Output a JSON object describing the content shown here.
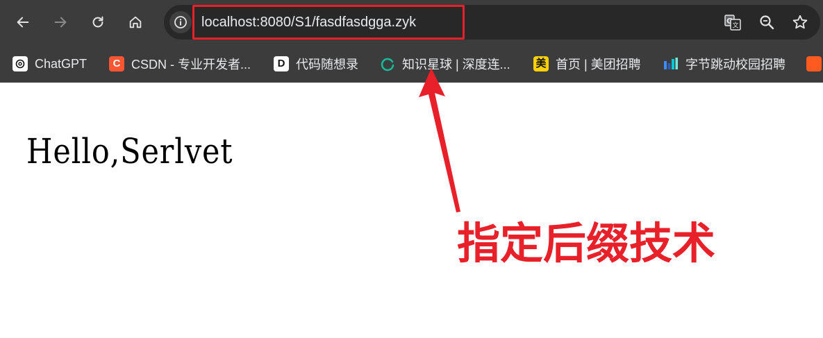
{
  "toolbar": {
    "back_icon": "arrow-left-icon",
    "forward_icon": "arrow-right-icon",
    "reload_icon": "reload-icon",
    "home_icon": "home-icon",
    "url": "localhost:8080/S1/fasdfasdgga.zyk",
    "translate_icon": "translate-icon",
    "zoom_icon": "magnifier-icon",
    "bookmark_icon": "star-icon"
  },
  "bookmarks": [
    {
      "label": "ChatGPT",
      "icon": "chatgpt-icon"
    },
    {
      "label": "CSDN - 专业开发者...",
      "icon": "csdn-icon",
      "icon_text": "C",
      "color": "#fc5531"
    },
    {
      "label": "代码随想录",
      "icon": "daimasuixianglu-icon",
      "icon_text": "D"
    },
    {
      "label": "知识星球 | 深度连...",
      "icon": "zsxq-icon"
    },
    {
      "label": "首页 | 美团招聘",
      "icon": "meituan-icon",
      "icon_text": "美",
      "color": "#ffd100"
    },
    {
      "label": "字节跳动校园招聘",
      "icon": "bytedance-icon"
    }
  ],
  "page": {
    "heading": "Hello,Serlvet"
  },
  "annotation": {
    "text": "指定后缀技术",
    "color": "#e8202a"
  }
}
